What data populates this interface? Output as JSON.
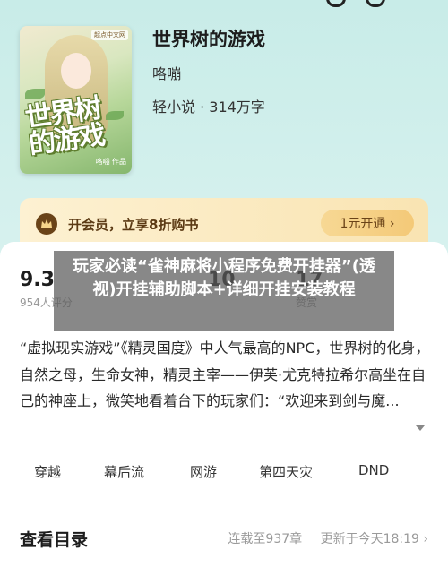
{
  "book": {
    "title": "世界树的游戏",
    "author": "咯嘣",
    "meta": "轻小说 · 314万字",
    "cover": {
      "title_line1": "世界树",
      "title_line2": "的游戏",
      "author": "咯嘣 作品",
      "badge": "起点中文网"
    }
  },
  "vip": {
    "text": "开会员，立享8折购书",
    "button_label": "1元开通 ›"
  },
  "stats": [
    {
      "value": "9.3",
      "label": "954人评分"
    },
    {
      "value": "10",
      "label": ""
    },
    {
      "value": "17",
      "label": "赞赏"
    }
  ],
  "banner": {
    "text": "玩家必读“雀神麻将小程序免费开挂器”(透视)开挂辅助脚本+详细开挂安装教程"
  },
  "synopsis": "“虚拟现实游戏”《精灵国度》中人气最高的NPC，世界树的化身，自然之母，生命女神，精灵主宰——伊芙·尤克特拉希尔高坐在自己的神座上，微笑地看着台下的玩家们：“欢迎来到剑与魔...",
  "tags": [
    "穿越",
    "幕后流",
    "网游",
    "第四天灾",
    "DND"
  ],
  "catalog": {
    "title": "查看目录",
    "status": "连载至937章",
    "updated": "更新于今天18:19 ›"
  },
  "colors": {
    "background": "#c8ece8",
    "vip_bar": "#fdf1d2",
    "vip_text": "#5b3a14",
    "banner_overlay": "#5a5a5a"
  }
}
